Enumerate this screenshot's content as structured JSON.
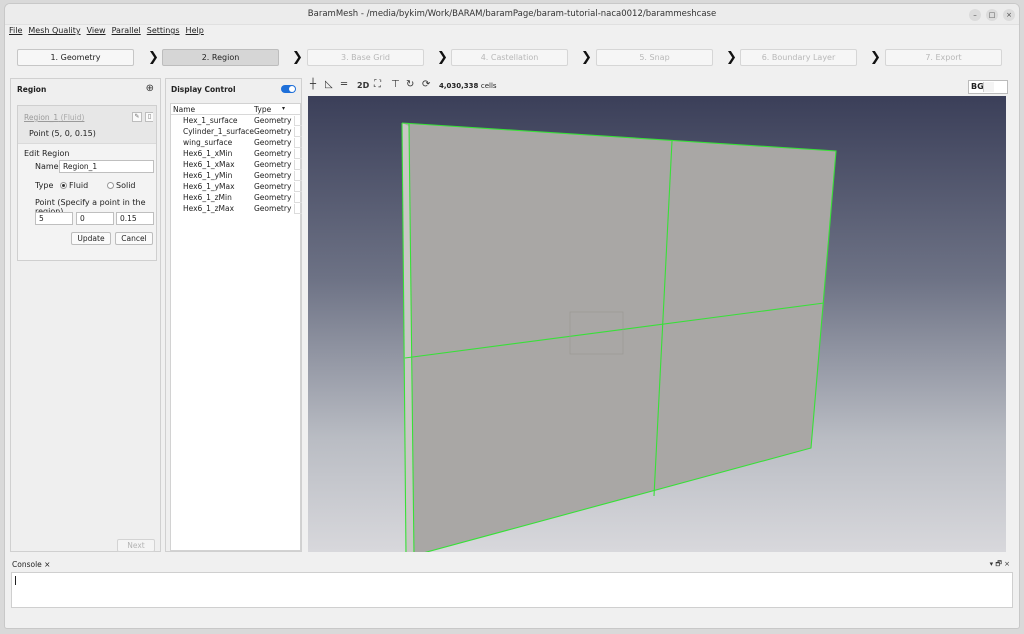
{
  "window": {
    "title": "BaramMesh - /media/bykim/Work/BARAM/baramPage/baram-tutorial-naca0012/barammeshcase",
    "controls": {
      "minimize": "–",
      "maximize": "□",
      "close": "×"
    }
  },
  "menu": {
    "items": [
      "File",
      "Mesh Quality",
      "View",
      "Parallel",
      "Settings",
      "Help"
    ]
  },
  "steps": [
    {
      "label": "1. Geometry",
      "state": "normal"
    },
    {
      "label": "2. Region",
      "state": "active"
    },
    {
      "label": "3. Base Grid",
      "state": "disabled"
    },
    {
      "label": "4. Castellation",
      "state": "disabled"
    },
    {
      "label": "5. Snap",
      "state": "disabled"
    },
    {
      "label": "6. Boundary Layer",
      "state": "disabled"
    },
    {
      "label": "7. Export",
      "state": "disabled"
    }
  ],
  "region_panel": {
    "header": "Region",
    "add_icon": "⊕",
    "region": {
      "name": "Region_1",
      "type_label": "(Fluid)",
      "point_text": "Point  (5, 0, 0.15)"
    },
    "edit": {
      "title": "Edit Region",
      "name_label": "Name",
      "name_value": "Region_1",
      "type_label": "Type",
      "type_options": [
        "Fluid",
        "Solid"
      ],
      "type_selected": "Fluid",
      "point_label": "Point (Specify a point in the region)",
      "point_values": [
        "5",
        "0",
        "0.15"
      ],
      "update_label": "Update",
      "cancel_label": "Cancel"
    },
    "next_label": "Next"
  },
  "display_control": {
    "header": "Display Control",
    "columns": [
      "Name",
      "Type"
    ],
    "rows": [
      {
        "name": "Hex_1_surface",
        "type": "Geometry"
      },
      {
        "name": "Cylinder_1_surface",
        "type": "Geometry"
      },
      {
        "name": "wing_surface",
        "type": "Geometry"
      },
      {
        "name": "Hex6_1_xMin",
        "type": "Geometry"
      },
      {
        "name": "Hex6_1_xMax",
        "type": "Geometry"
      },
      {
        "name": "Hex6_1_yMin",
        "type": "Geometry"
      },
      {
        "name": "Hex6_1_yMax",
        "type": "Geometry"
      },
      {
        "name": "Hex6_1_zMin",
        "type": "Geometry"
      },
      {
        "name": "Hex6_1_zMax",
        "type": "Geometry"
      }
    ]
  },
  "viewer": {
    "toolbar_icons": [
      "axes-icon",
      "ruler-icon",
      "outline-icon",
      "2d-mode-icon",
      "fit-view-icon",
      "align-top-icon",
      "rotate-icon",
      "rotate-plus-icon"
    ],
    "label_2d": "2D",
    "cell_count": "4,030,338",
    "cell_unit": "cells",
    "bg_label": "BG",
    "accent_color": "#3ce03c"
  },
  "console": {
    "tab_label": "Console",
    "close": "×",
    "controls": "▾ 🗗 ×"
  }
}
